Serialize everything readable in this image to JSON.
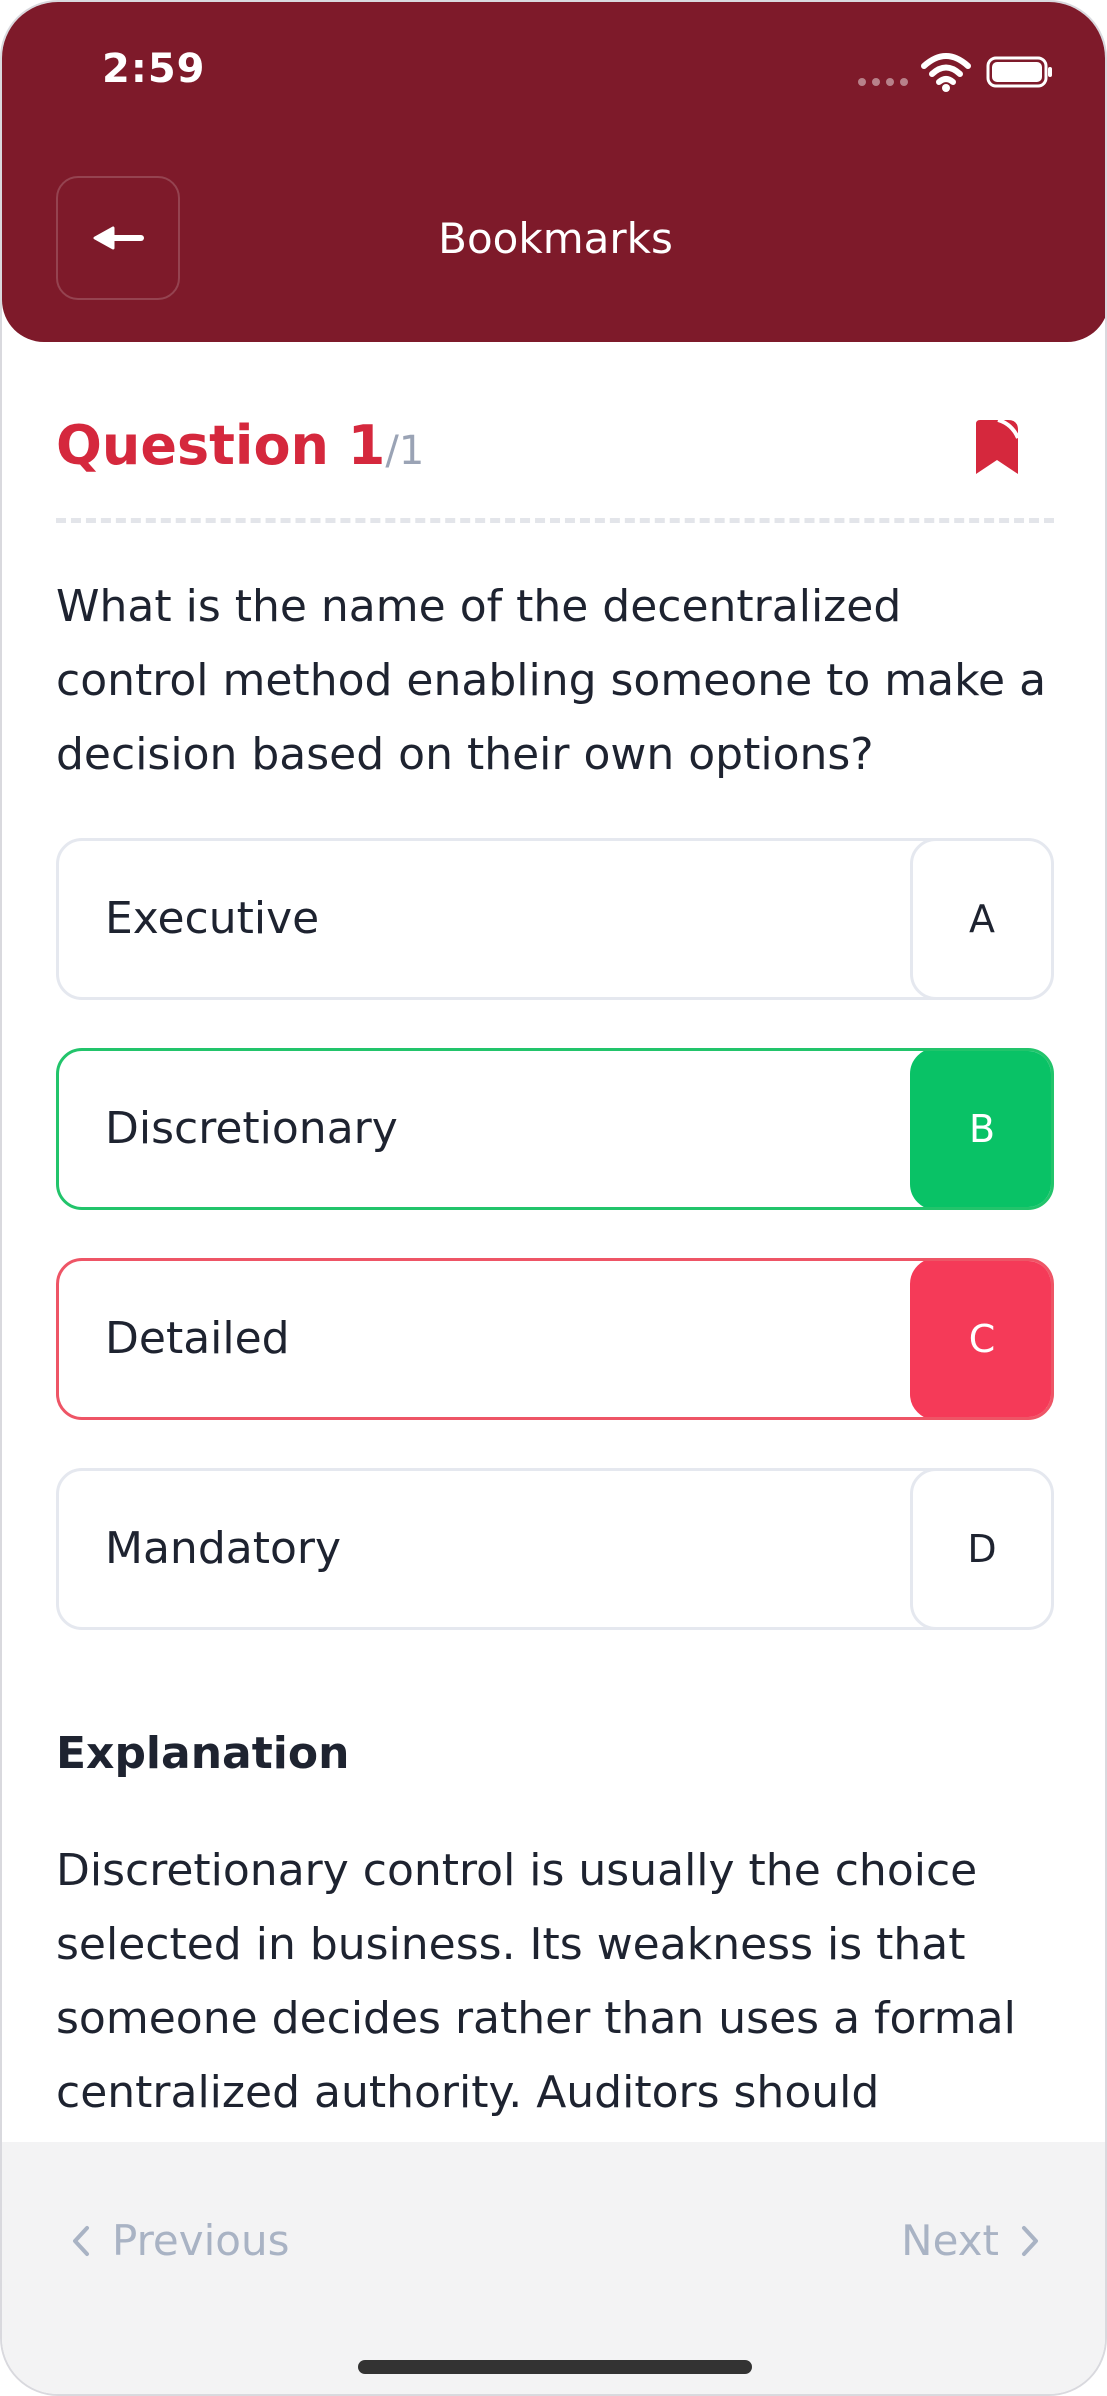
{
  "status_bar": {
    "time": "2:59"
  },
  "header": {
    "title": "Bookmarks"
  },
  "question": {
    "label": "Question 1",
    "total": "/1",
    "text": "What is the name of the decentralized control method enabling someone to make a decision based on their own options?"
  },
  "options": [
    {
      "label": "Executive",
      "letter": "A",
      "state": "neutral"
    },
    {
      "label": "Discretionary",
      "letter": "B",
      "state": "correct"
    },
    {
      "label": "Detailed",
      "letter": "C",
      "state": "wrong"
    },
    {
      "label": "Mandatory",
      "letter": "D",
      "state": "neutral"
    }
  ],
  "explanation": {
    "title": "Explanation",
    "text": "Discretionary control is usually the choice selected in business. Its weakness is that someone decides rather than uses a formal centralized authority. Auditors should"
  },
  "navigation": {
    "previous_label": "Previous",
    "next_label": "Next"
  },
  "colors": {
    "header_bg": "#7e1a2a",
    "accent_red": "#d5283d",
    "correct_green": "#09c266",
    "wrong_red": "#f53a58"
  }
}
